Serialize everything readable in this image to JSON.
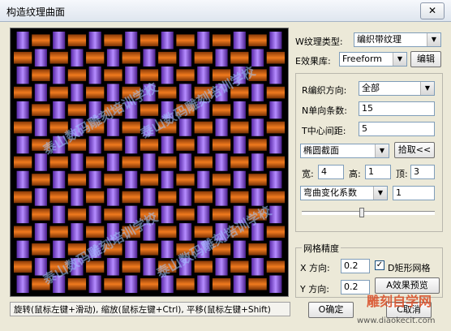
{
  "window": {
    "title": "构造纹理曲面",
    "close_label": "✕"
  },
  "canvas": {
    "colors": {
      "background": "#000000",
      "warp": "#b58cff",
      "weft": "#f07a1e"
    },
    "watermarks": [
      "泰山数码雕刻培训学校",
      "泰山数码雕刻培训学校",
      "泰山数码雕刻培训学校",
      "泰山数码雕刻培训学校"
    ]
  },
  "status": {
    "text": "旋转(鼠标左键+滑动), 缩放(鼠标左键+Ctrl), 平移(鼠标左键+Shift)"
  },
  "top": {
    "texture_type_label": "W纹理类型:",
    "texture_type_value": "编织带纹理",
    "effect_lib_label": "E效果库:",
    "effect_lib_value": "Freeform",
    "edit_button": "编辑"
  },
  "params": {
    "direction_label": "R编织方向:",
    "direction_value": "全部",
    "count_label": "N单向条数:",
    "count_value": "15",
    "spacing_label": "T中心间距:",
    "spacing_value": "5",
    "section_value": "椭圆截面",
    "pick_button": "拾取<<",
    "width_label": "宽:",
    "width_value": "4",
    "height_label": "高:",
    "height_value": "1",
    "top_label": "顶:",
    "top_value": "3",
    "bend_value": "弯曲变化系数",
    "bend_factor": "1",
    "slider_value": 0.45
  },
  "precision": {
    "group_label": "网格精度",
    "x_label": "X 方向:",
    "x_value": "0.2",
    "rect_grid_label": "D矩形网格",
    "rect_grid_checked": "✓",
    "y_label": "Y 方向:",
    "y_value": "0.2",
    "preview_button": "A效果预览"
  },
  "buttons": {
    "ok": "O确定",
    "cancel": "C取消"
  },
  "brand": {
    "name": "雕刻自学网",
    "url": "www.diaokecit.com"
  }
}
